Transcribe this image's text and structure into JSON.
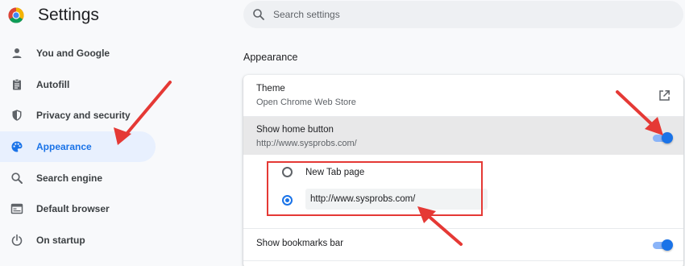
{
  "header": {
    "title": "Settings",
    "logo_icon": "chrome-logo-icon"
  },
  "search": {
    "placeholder": "Search settings",
    "icon": "search-icon"
  },
  "sidebar": {
    "items": [
      {
        "label": "You and Google",
        "icon": "person-icon",
        "active": false
      },
      {
        "label": "Autofill",
        "icon": "clipboard-icon",
        "active": false
      },
      {
        "label": "Privacy and security",
        "icon": "shield-icon",
        "active": false
      },
      {
        "label": "Appearance",
        "icon": "palette-icon",
        "active": true
      },
      {
        "label": "Search engine",
        "icon": "search-icon",
        "active": false
      },
      {
        "label": "Default browser",
        "icon": "browser-window-icon",
        "active": false
      },
      {
        "label": "On startup",
        "icon": "power-icon",
        "active": false
      }
    ]
  },
  "appearance": {
    "section_title": "Appearance",
    "theme": {
      "title": "Theme",
      "subtitle": "Open Chrome Web Store",
      "icon": "open-external-icon"
    },
    "home_button": {
      "title": "Show home button",
      "subtitle": "http://www.sysprobs.com/",
      "enabled": true
    },
    "home_options": {
      "new_tab_label": "New Tab page",
      "new_tab_selected": false,
      "custom_selected": true,
      "custom_url_value": "http://www.sysprobs.com/"
    },
    "bookmarks_bar": {
      "title": "Show bookmarks bar",
      "enabled": true
    }
  },
  "colors": {
    "accent": "#1a73e8",
    "annotation": "#e53935",
    "active_nav_bg": "#e8f0fe"
  }
}
